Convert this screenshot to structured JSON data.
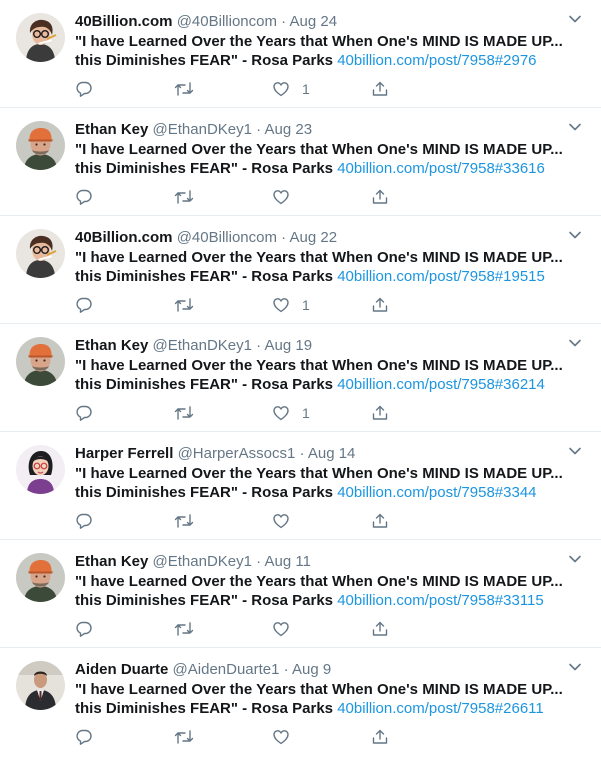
{
  "tweets": [
    {
      "name": "40Billion.com",
      "handle": "@40Billioncom",
      "separator": "·",
      "date": "Aug 24",
      "text_line1": "\"I have Learned Over the Years that When One's MIND IS MADE UP...",
      "text_line2": "this Diminishes FEAR\" - Rosa Parks",
      "link": "40billion.com/post/7958#2976",
      "like_count": "1",
      "avatar": "woman-glasses"
    },
    {
      "name": "Ethan Key",
      "handle": "@EthanDKey1",
      "separator": "·",
      "date": "Aug 23",
      "text_line1": "\"I have Learned Over the Years that When One's MIND IS MADE UP...",
      "text_line2": "this Diminishes FEAR\" - Rosa Parks",
      "link": "40billion.com/post/7958#33616",
      "like_count": "",
      "avatar": "man-orange-cap"
    },
    {
      "name": "40Billion.com",
      "handle": "@40Billioncom",
      "separator": "·",
      "date": "Aug 22",
      "text_line1": "\"I have Learned Over the Years that When One's MIND IS MADE UP...",
      "text_line2": "this Diminishes FEAR\" - Rosa Parks",
      "link": "40billion.com/post/7958#19515",
      "like_count": "1",
      "avatar": "woman-glasses"
    },
    {
      "name": "Ethan Key",
      "handle": "@EthanDKey1",
      "separator": "·",
      "date": "Aug 19",
      "text_line1": "\"I have Learned Over the Years that When One's MIND IS MADE UP...",
      "text_line2": "this Diminishes FEAR\" - Rosa Parks",
      "link": "40billion.com/post/7958#36214",
      "like_count": "1",
      "avatar": "man-orange-cap"
    },
    {
      "name": "Harper Ferrell",
      "handle": "@HarperAssocs1",
      "separator": "·",
      "date": "Aug 14",
      "text_line1": "\"I have Learned Over the Years that When One's MIND IS MADE UP...",
      "text_line2": "this Diminishes FEAR\" - Rosa Parks",
      "link": "40billion.com/post/7958#3344",
      "like_count": "",
      "avatar": "cartoon-woman"
    },
    {
      "name": "Ethan Key",
      "handle": "@EthanDKey1",
      "separator": "·",
      "date": "Aug 11",
      "text_line1": "\"I have Learned Over the Years that When One's MIND IS MADE UP...",
      "text_line2": "this Diminishes FEAR\" - Rosa Parks",
      "link": "40billion.com/post/7958#33115",
      "like_count": "",
      "avatar": "man-orange-cap"
    },
    {
      "name": "Aiden Duarte",
      "handle": "@AidenDuarte1",
      "separator": "·",
      "date": "Aug 9",
      "text_line1": "\"I have Learned Over the Years that When One's MIND IS MADE UP...",
      "text_line2": "this Diminishes FEAR\" - Rosa Parks",
      "link": "40billion.com/post/7958#26611",
      "like_count": "",
      "avatar": "man-suit"
    }
  ],
  "colors": {
    "text": "#14171a",
    "secondary": "#657786",
    "link": "#1b95e0",
    "divider": "#e6ecf0"
  }
}
